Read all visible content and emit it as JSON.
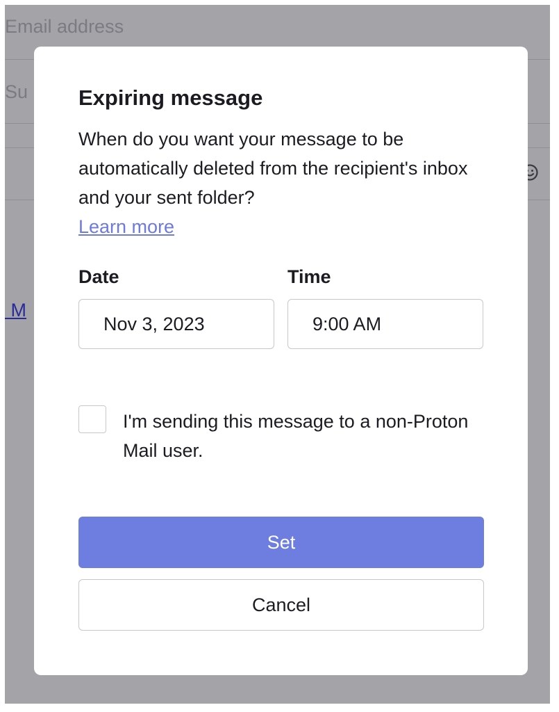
{
  "background": {
    "email_placeholder": "Email address",
    "subject_placeholder": "Su",
    "link_fragment": "n M",
    "emoji_icon": "smiley-icon"
  },
  "modal": {
    "title": "Expiring message",
    "description": "When do you want your message to be automatically deleted from the recipient's inbox and your sent folder?",
    "learn_more": "Learn more",
    "date_label": "Date",
    "date_value": "Nov 3, 2023",
    "time_label": "Time",
    "time_value": "9:00 AM",
    "checkbox_label": "I'm sending this message to a non-Proton Mail user.",
    "checkbox_checked": false,
    "set_label": "Set",
    "cancel_label": "Cancel"
  },
  "colors": {
    "accent": "#6d7de0",
    "overlay": "#a3a3a8",
    "link": "#6d7adf"
  }
}
